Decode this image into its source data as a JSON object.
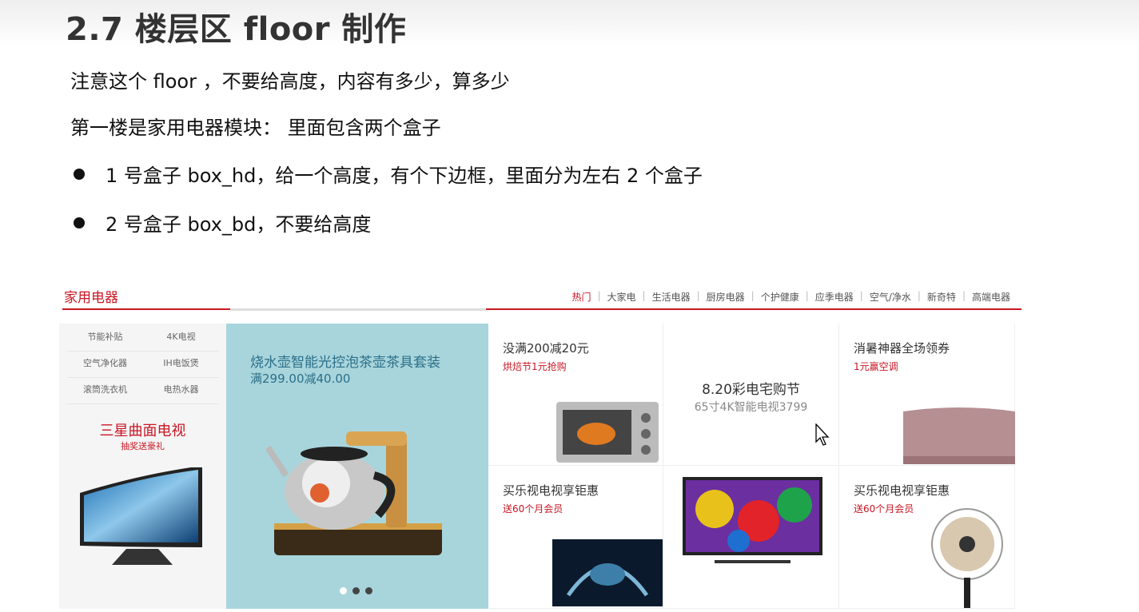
{
  "slide": {
    "title": "2.7 楼层区 floor 制作",
    "note1": "注意这个 floor ，不要给高度，内容有多少，算多少",
    "note2": "第一楼是家用电器模块： 里面包含两个盒子",
    "bullets": [
      "1 号盒子 box_hd，给一个高度，有个下边框，里面分为左右 2 个盒子",
      "2 号盒子 box_bd，不要给高度"
    ]
  },
  "floor": {
    "title": "家用电器",
    "tabs": [
      "热门",
      "大家电",
      "生活电器",
      "厨房电器",
      "个护健康",
      "应季电器",
      "空气/净水",
      "新奇特",
      "高端电器"
    ],
    "quick_links": [
      "节能补贴",
      "4K电视",
      "空气净化器",
      "IH电饭煲",
      "滚筒洗衣机",
      "电热水器"
    ],
    "col1_promo": {
      "title": "三星曲面电视",
      "sub": "抽奖送豪礼"
    },
    "col2_promo": {
      "title": "烧水壶智能光控泡茶壶茶具套装",
      "sub": "满299.00减40.00"
    },
    "cells": [
      {
        "title": "没满200减20元",
        "sub": "烘焙节1元抢购"
      },
      {
        "title": "8.20彩电宅购节",
        "sub": "65寸4K智能电视3799"
      },
      {
        "title": "消暑神器全场领券",
        "sub": "1元赢空调"
      },
      {
        "title": "买乐视电视享钜惠",
        "sub": "送60个月会员"
      },
      {
        "title": "",
        "sub": ""
      },
      {
        "title": "买乐视电视享钜惠",
        "sub": "送60个月会员"
      }
    ]
  },
  "colors": {
    "brand_red": "#c81623",
    "kettle_bg": "#a8d5dc"
  }
}
